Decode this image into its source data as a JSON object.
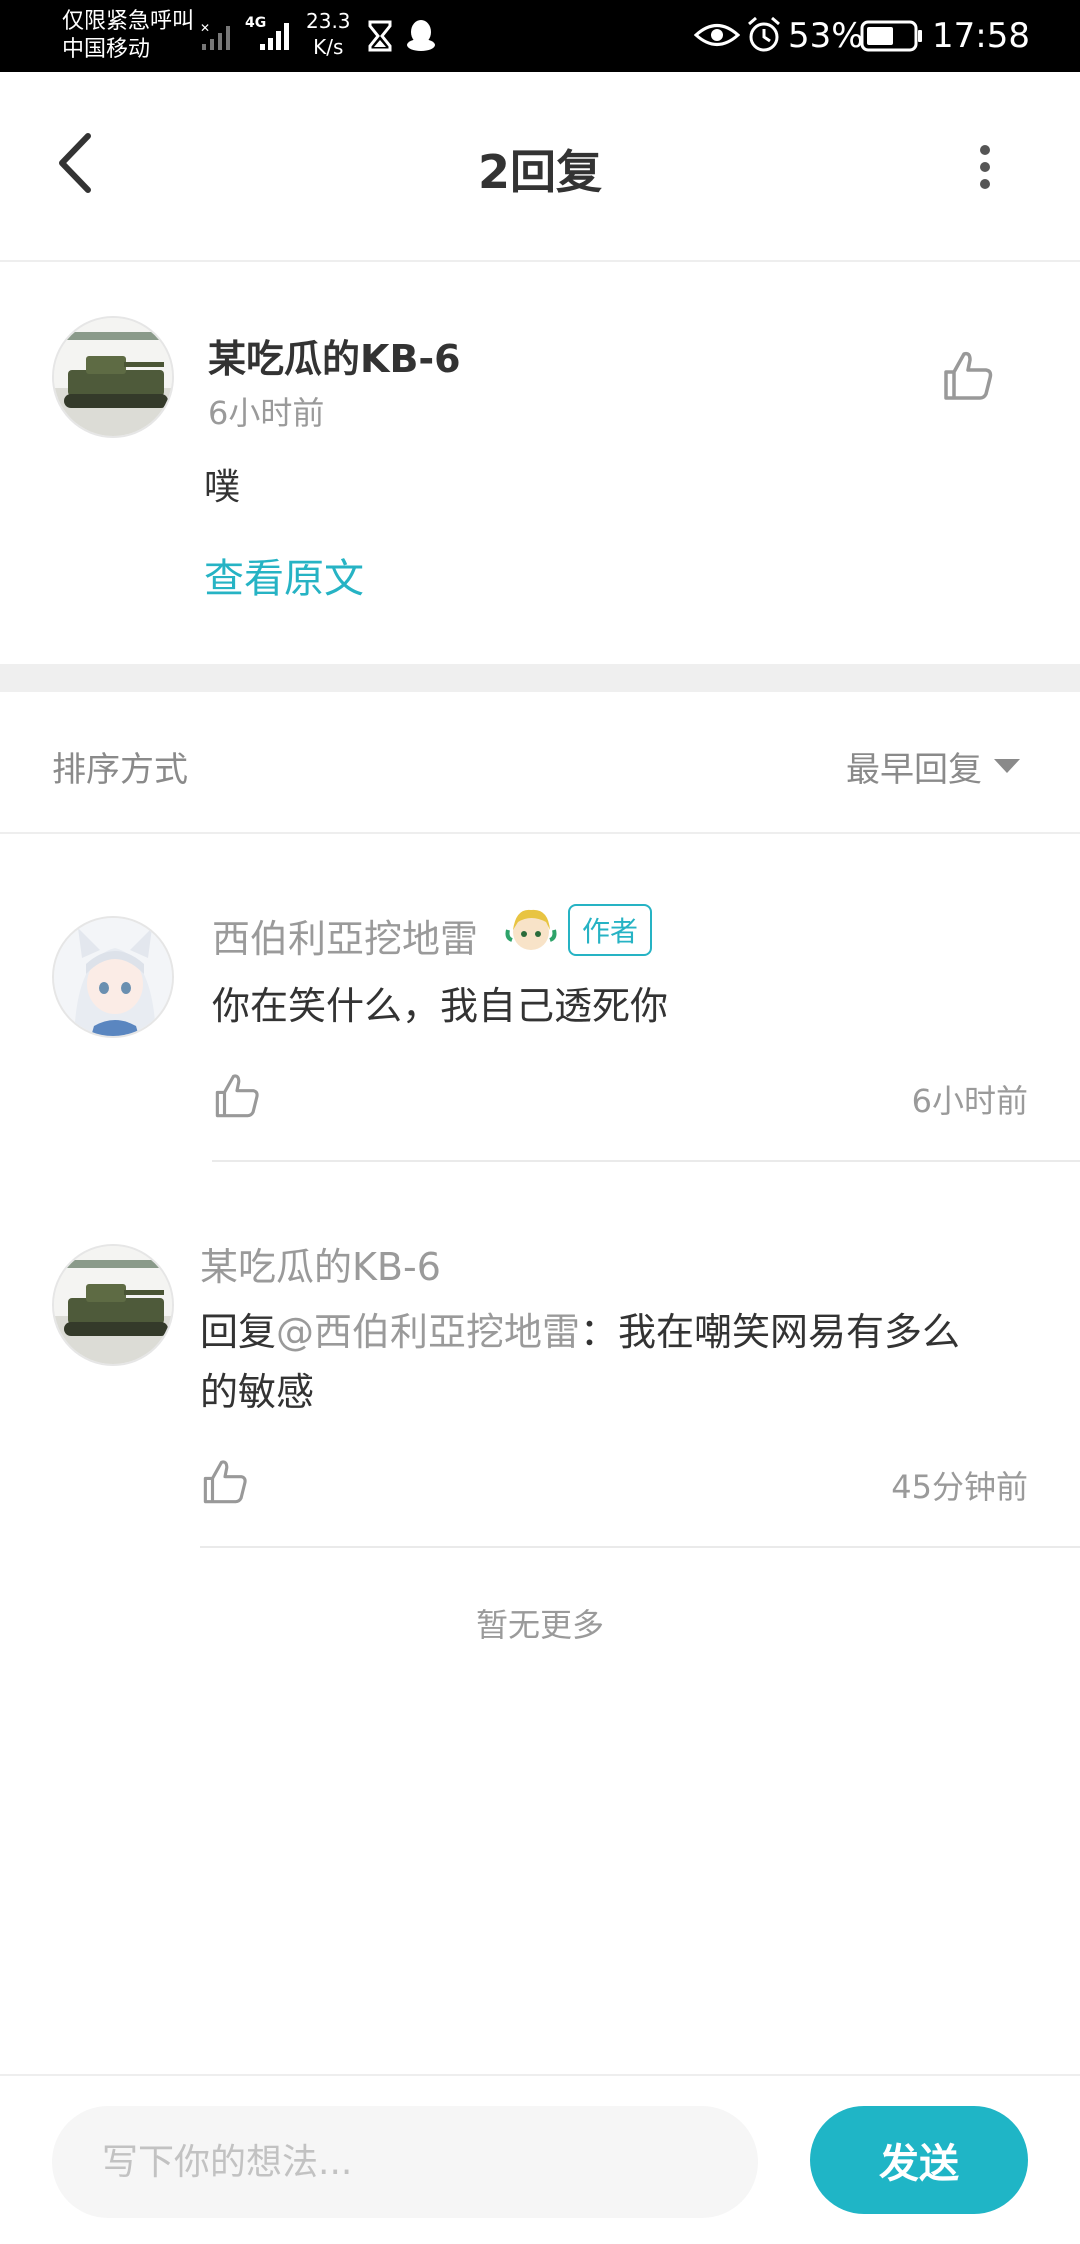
{
  "status_bar": {
    "carrier_line1": "仅限紧急呼叫",
    "carrier_line2": "中国移动",
    "network_type": "4G",
    "speed_value": "23.3",
    "speed_unit": "K/s",
    "battery_percent": "53%",
    "time": "17:58",
    "icons": [
      "signal-x-icon",
      "signal-icon",
      "hourglass-icon",
      "qq-icon",
      "eye-icon",
      "alarm-icon",
      "battery-icon"
    ]
  },
  "header": {
    "title": "2回复",
    "back_icon": "chevron-left-icon",
    "more_icon": "more-vertical-icon"
  },
  "original_comment": {
    "author": "某吃瓜的KB-6",
    "time": "6小时前",
    "content": "噗",
    "view_original_label": "查看原文",
    "like_icon": "thumbs-up-icon"
  },
  "sort": {
    "label": "排序方式",
    "value": "最早回复",
    "caret_icon": "caret-down-icon"
  },
  "replies": [
    {
      "author": "西伯利亞挖地雷",
      "badge": "作者",
      "badge_emoji": "avatar-badge-icon",
      "content": "你在笑什么，我自己透死你",
      "time": "6小时前"
    },
    {
      "author": "某吃瓜的KB-6",
      "content_prefix": "回复",
      "mention": "@西伯利亞挖地雷",
      "content_line1_rest": "：我在嘲笑网易有多么",
      "content_line2": "的敏感",
      "time": "45分钟前"
    }
  ],
  "footer_note": "暂无更多",
  "composer": {
    "placeholder": "写下你的想法...",
    "value": "",
    "send_label": "发送"
  },
  "colors": {
    "accent": "#26b3c4",
    "send_button": "#1fb5c6",
    "muted_text": "#9a9a9a",
    "divider": "#eeeeee"
  }
}
